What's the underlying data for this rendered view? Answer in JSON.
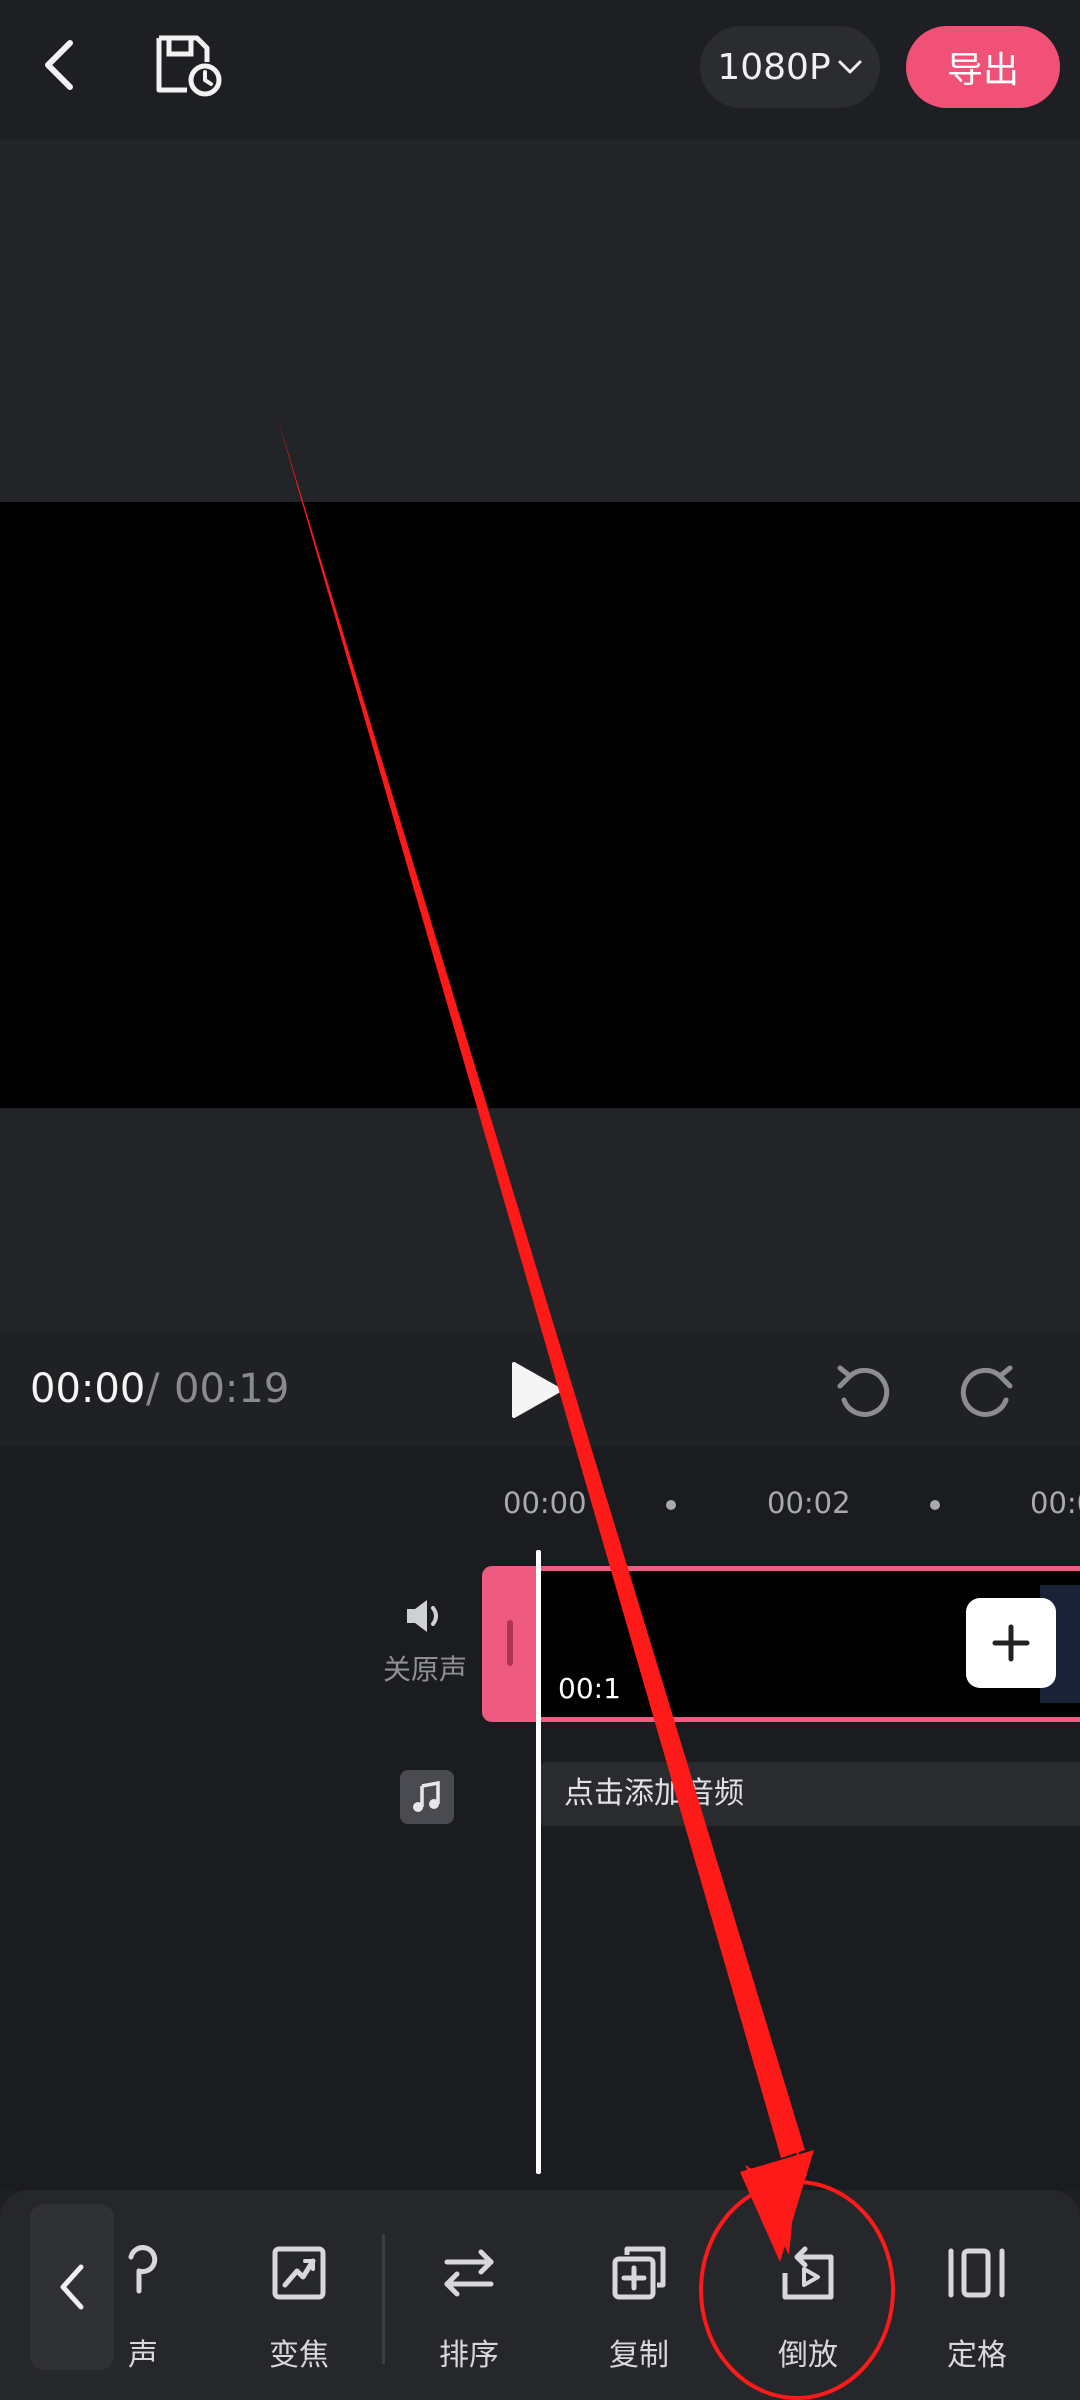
{
  "header": {
    "resolution_label": "1080P",
    "export_label": "导出"
  },
  "playback": {
    "current_time": "00:00",
    "separator": "/",
    "total_time": "00:19"
  },
  "timeline": {
    "ruler": [
      "00:00",
      "00:02",
      "00:0"
    ],
    "audio_toggle_label": "关原声",
    "clip_time": "00:1",
    "audio_track_placeholder": "点击添加音频"
  },
  "toolbar": {
    "tools": [
      {
        "label": "声",
        "icon": "voice-icon"
      },
      {
        "label": "变焦",
        "icon": "zoom-icon"
      },
      {
        "label": "排序",
        "icon": "sort-icon"
      },
      {
        "label": "复制",
        "icon": "copy-icon"
      },
      {
        "label": "倒放",
        "icon": "reverse-icon"
      },
      {
        "label": "定格",
        "icon": "freeze-icon"
      }
    ]
  },
  "colors": {
    "accent": "#f25177",
    "annotation": "#ff0000"
  }
}
